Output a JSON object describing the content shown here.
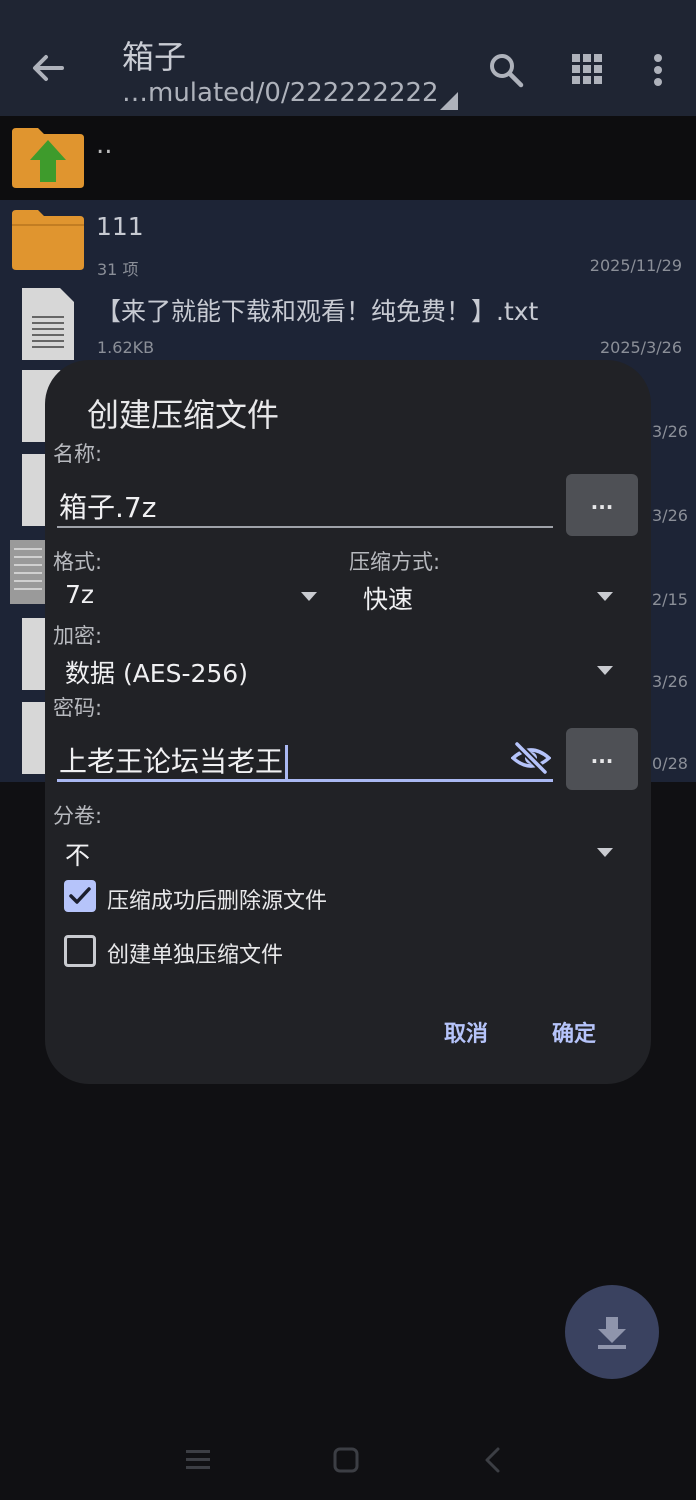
{
  "appbar": {
    "title": "箱子",
    "path": "…mulated/0/222222222",
    "icons": [
      "back-arrow-icon",
      "search-icon",
      "grid-view-icon",
      "more-vert-icon"
    ]
  },
  "files": {
    "parent_label": "..",
    "items": [
      {
        "name": "111",
        "meta": "31 项",
        "date": "2025/11/29",
        "type": "folder"
      },
      {
        "name": "【来了就能下载和观看！纯免费！】.txt",
        "meta": "1.62KB",
        "date": "2025/3/26",
        "type": "text"
      }
    ],
    "hidden_date_fragments": [
      "3/26",
      "3/26",
      "2/15",
      "3/26",
      "0/28"
    ]
  },
  "dialog": {
    "title": "创建压缩文件",
    "name_label": "名称:",
    "name_value": "箱子.7z",
    "browse_label": "...",
    "format_label": "格式:",
    "format_value": "7z",
    "method_label": "压缩方式:",
    "method_value": "快速",
    "encryption_label": "加密:",
    "encryption_value": "数据 (AES-256)",
    "password_label": "密码:",
    "password_value": "上老王论坛当老王",
    "password_extra_label": "...",
    "split_label": "分卷:",
    "split_value": "不",
    "delete_source_label": "压缩成功后删除源文件",
    "delete_source_checked": true,
    "separate_archive_label": "创建单独压缩文件",
    "separate_archive_checked": false,
    "cancel_label": "取消",
    "ok_label": "确定"
  },
  "colors": {
    "appbar_bg": "#1f2533",
    "dialog_bg": "#212226",
    "accent": "#b6c4fa",
    "folder": "#e0952f",
    "up_arrow": "#3e9b2c"
  }
}
